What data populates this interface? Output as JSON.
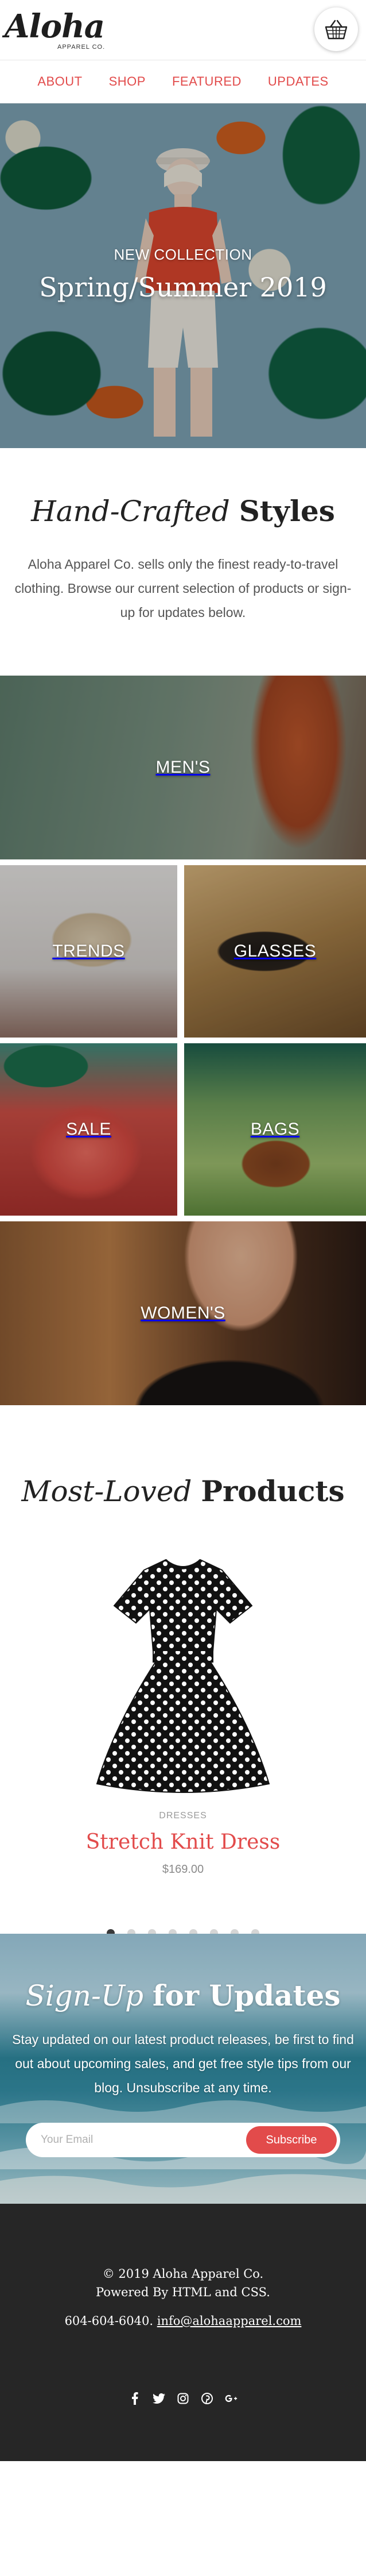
{
  "brand": {
    "name": "Aloha",
    "tagline": "APPAREL CO."
  },
  "nav": {
    "items": [
      {
        "label": "ABOUT"
      },
      {
        "label": "SHOP"
      },
      {
        "label": "FEATURED"
      },
      {
        "label": "UPDATES"
      }
    ]
  },
  "hero": {
    "kicker": "NEW COLLECTION",
    "title": "Spring/Summer 2019"
  },
  "intro": {
    "heading_italic": "Hand-Crafted",
    "heading_bold": "Styles",
    "body": "Aloha Apparel Co. sells only the finest ready-to-travel clothing. Browse our current selection of products or sign-up for updates below."
  },
  "categories": {
    "men": "MEN'S",
    "trends": "TRENDS",
    "glasses": "GLASSES",
    "sale": "SALE",
    "bags": "BAGS",
    "women": "WOMEN'S"
  },
  "products": {
    "heading_italic": "Most-Loved",
    "heading_bold": "Products",
    "featured": {
      "category": "DRESSES",
      "name": "Stretch Knit Dress",
      "price": "$169.00"
    },
    "slide_count": 8,
    "active_slide": 1
  },
  "signup": {
    "heading_italic": "Sign-Up",
    "heading_bold": "for Updates",
    "body": "Stay updated on our latest product releases, be first to find out about upcoming sales, and get free style tips from our blog. Unsubscribe at any time.",
    "email_placeholder": "Your Email",
    "button_label": "Subscribe"
  },
  "footer": {
    "copyright": "© 2019 Aloha Apparel Co.",
    "powered": "Powered By HTML and CSS.",
    "phone": "604-604-6040.",
    "email": "info@alohaapparel.com",
    "socials": [
      "facebook-icon",
      "twitter-icon",
      "instagram-icon",
      "pinterest-icon",
      "google-plus-icon"
    ]
  },
  "colors": {
    "accent": "#e24b4b",
    "footer_bg": "#262626",
    "text": "#3a3a3a"
  }
}
